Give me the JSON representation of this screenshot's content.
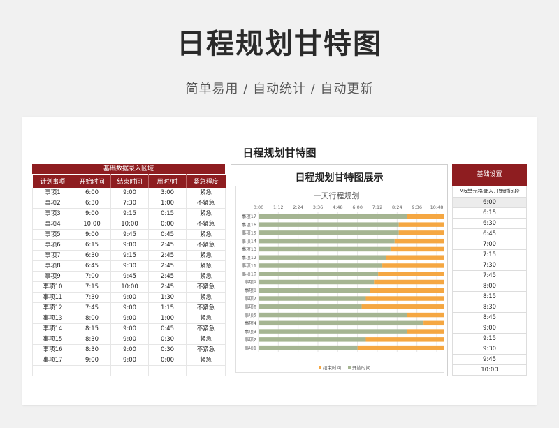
{
  "page": {
    "title": "日程规划甘特图",
    "subtitle": "简单易用 / 自动统计 / 自动更新",
    "sheet_title": "日程规划甘特图"
  },
  "left": {
    "banner": "基础数据录入区域",
    "headers": [
      "计划事项",
      "开始时间",
      "结束时间",
      "用时/时",
      "紧急程度"
    ],
    "rows": [
      [
        "事项1",
        "6:00",
        "9:00",
        "3:00",
        "紧急"
      ],
      [
        "事项2",
        "6:30",
        "7:30",
        "1:00",
        "不紧急"
      ],
      [
        "事项3",
        "9:00",
        "9:15",
        "0:15",
        "紧急"
      ],
      [
        "事项4",
        "10:00",
        "10:00",
        "0:00",
        "不紧急"
      ],
      [
        "事项5",
        "9:00",
        "9:45",
        "0:45",
        "紧急"
      ],
      [
        "事项6",
        "6:15",
        "9:00",
        "2:45",
        "不紧急"
      ],
      [
        "事项7",
        "6:30",
        "9:15",
        "2:45",
        "紧急"
      ],
      [
        "事项8",
        "6:45",
        "9:30",
        "2:45",
        "紧急"
      ],
      [
        "事项9",
        "7:00",
        "9:45",
        "2:45",
        "紧急"
      ],
      [
        "事项10",
        "7:15",
        "10:00",
        "2:45",
        "不紧急"
      ],
      [
        "事项11",
        "7:30",
        "9:00",
        "1:30",
        "紧急"
      ],
      [
        "事项12",
        "7:45",
        "9:00",
        "1:15",
        "不紧急"
      ],
      [
        "事项13",
        "8:00",
        "9:00",
        "1:00",
        "紧急"
      ],
      [
        "事项14",
        "8:15",
        "9:00",
        "0:45",
        "不紧急"
      ],
      [
        "事项15",
        "8:30",
        "9:00",
        "0:30",
        "紧急"
      ],
      [
        "事项16",
        "8:30",
        "9:00",
        "0:30",
        "不紧急"
      ],
      [
        "事项17",
        "9:00",
        "9:00",
        "0:00",
        "紧急"
      ]
    ],
    "empty_rows": 1
  },
  "chart": {
    "header": "日程规划甘特图展示",
    "colors": {
      "start": "#a5b592",
      "end": "#f5a742",
      "grid": "#e6e6e6"
    }
  },
  "chart_data": {
    "type": "bar",
    "title": "一天行程规划",
    "orientation": "horizontal-stacked",
    "x_ticks": [
      "0:00",
      "1:12",
      "2:24",
      "3:36",
      "4:48",
      "6:00",
      "7:12",
      "8:24",
      "9:36",
      "10:48"
    ],
    "xlim_hours": [
      0,
      10.8
    ],
    "categories": [
      "事项1",
      "事项2",
      "事项3",
      "事项4",
      "事项5",
      "事项6",
      "事项7",
      "事项8",
      "事项9",
      "事项10",
      "事项11",
      "事项12",
      "事项13",
      "事项14",
      "事项15",
      "事项16",
      "事项17"
    ],
    "series": [
      {
        "name": "开始时间",
        "values_hours": [
          6.0,
          6.5,
          9.0,
          10.0,
          9.0,
          6.25,
          6.5,
          6.75,
          7.0,
          7.25,
          7.5,
          7.75,
          8.0,
          8.25,
          8.5,
          8.5,
          9.0
        ]
      },
      {
        "name": "结束时间",
        "values_hours": [
          9.0,
          7.5,
          9.25,
          10.0,
          9.75,
          9.0,
          9.25,
          9.5,
          9.75,
          10.0,
          9.0,
          9.0,
          9.0,
          9.0,
          9.0,
          9.0,
          9.0
        ]
      }
    ],
    "legend": [
      "结束时间",
      "开始时间"
    ],
    "legend_position": "bottom"
  },
  "right": {
    "header": "基础设置",
    "subheader": "M6单元格录入开始时间段",
    "times": [
      "6:00",
      "6:15",
      "6:30",
      "6:45",
      "7:00",
      "7:15",
      "7:30",
      "7:45",
      "8:00",
      "8:15",
      "8:30",
      "8:45",
      "9:00",
      "9:15",
      "9:30",
      "9:45",
      "10:00"
    ]
  }
}
